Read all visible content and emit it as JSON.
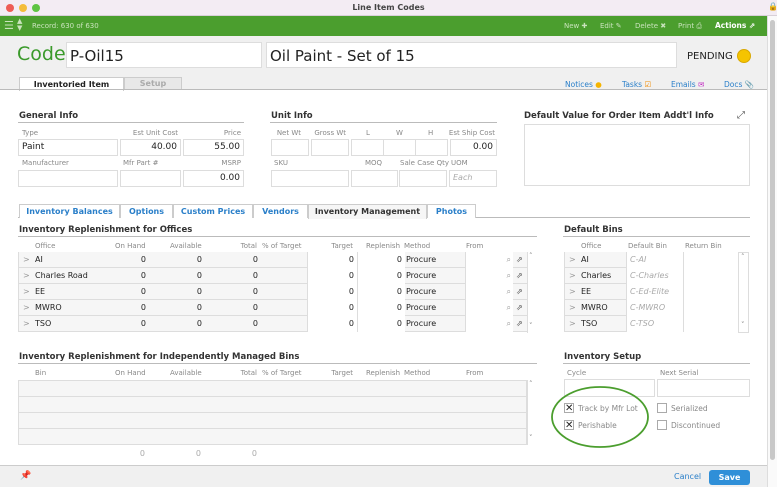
{
  "window": {
    "title": "Line Item Codes"
  },
  "toolbar": {
    "record": "Record: 630 of 630",
    "new": "New",
    "edit": "Edit",
    "delete": "Delete",
    "print": "Print",
    "actions": "Actions"
  },
  "header": {
    "code_label": "Code:",
    "code": "P-Oil15",
    "name": "Oil Paint - Set of 15",
    "status": "PENDING",
    "status_color": "#f5c400"
  },
  "main_tabs": [
    "Inventoried Item",
    "Setup"
  ],
  "links": {
    "notices": "Notices",
    "tasks": "Tasks",
    "emails": "Emails",
    "docs": "Docs"
  },
  "general": {
    "title": "General Info",
    "type_label": "Type",
    "type": "Paint",
    "cost_label": "Est Unit Cost",
    "cost": "40.00",
    "price_label": "Price",
    "price": "55.00",
    "mfr_label": "Manufacturer",
    "mfr": "",
    "part_label": "Mfr Part #",
    "part": "",
    "msrp_label": "MSRP",
    "msrp": "0.00"
  },
  "unit": {
    "title": "Unit Info",
    "net": "Net Wt",
    "gross": "Gross Wt",
    "l": "L",
    "w": "W",
    "h": "H",
    "ship_label": "Est Ship Cost",
    "ship": "0.00",
    "sku": "SKU",
    "moq": "MOQ",
    "case": "Sale Case Qty",
    "uom": "UOM",
    "uom_placeholder": "Each"
  },
  "default_value": {
    "title": "Default Value for Order Item Addt'l Info"
  },
  "sub_tabs": [
    "Inventory Balances",
    "Options",
    "Custom Prices",
    "Vendors",
    "Inventory Management",
    "Photos"
  ],
  "replen": {
    "title": "Inventory Replenishment for Offices",
    "columns": [
      "Office",
      "On Hand",
      "Available",
      "Total",
      "% of Target",
      "Target",
      "Replenish",
      "Method",
      "From"
    ],
    "rows": [
      {
        "office": "AI",
        "on_hand": "0",
        "available": "0",
        "total": "0",
        "pct": "",
        "target": "0",
        "replenish": "0",
        "method": "Procure"
      },
      {
        "office": "Charles Road",
        "on_hand": "0",
        "available": "0",
        "total": "0",
        "pct": "",
        "target": "0",
        "replenish": "0",
        "method": "Procure"
      },
      {
        "office": "EE",
        "on_hand": "0",
        "available": "0",
        "total": "0",
        "pct": "",
        "target": "0",
        "replenish": "0",
        "method": "Procure"
      },
      {
        "office": "MWRO",
        "on_hand": "0",
        "available": "0",
        "total": "0",
        "pct": "",
        "target": "0",
        "replenish": "0",
        "method": "Procure"
      },
      {
        "office": "TSO",
        "on_hand": "0",
        "available": "0",
        "total": "0",
        "pct": "",
        "target": "0",
        "replenish": "0",
        "method": "Procure"
      }
    ]
  },
  "bins": {
    "title": "Default Bins",
    "columns": [
      "Office",
      "Default Bin",
      "Return Bin"
    ],
    "rows": [
      {
        "office": "AI",
        "bin": "C-AI"
      },
      {
        "office": "Charles",
        "bin": "C-Charles"
      },
      {
        "office": "EE",
        "bin": "C-Ed-Elite"
      },
      {
        "office": "MWRO",
        "bin": "C-MWRO"
      },
      {
        "office": "TSO",
        "bin": "C-TSO"
      }
    ]
  },
  "indep": {
    "title": "Inventory Replenishment for Independently Managed Bins",
    "columns": [
      "Bin",
      "On Hand",
      "Available",
      "Total",
      "% of Target",
      "Target",
      "Replenish",
      "Method",
      "From"
    ],
    "totals": [
      "0",
      "0",
      "0"
    ]
  },
  "setup": {
    "title": "Inventory Setup",
    "cycle": "Cycle",
    "next_serial": "Next Serial",
    "track": "Track by Mfr Lot",
    "track_checked": true,
    "perishable": "Perishable",
    "perishable_checked": true,
    "serialized": "Serialized",
    "serialized_checked": false,
    "discontinued": "Discontinued",
    "discontinued_checked": false
  },
  "footer": {
    "cancel": "Cancel",
    "save": "Save"
  }
}
